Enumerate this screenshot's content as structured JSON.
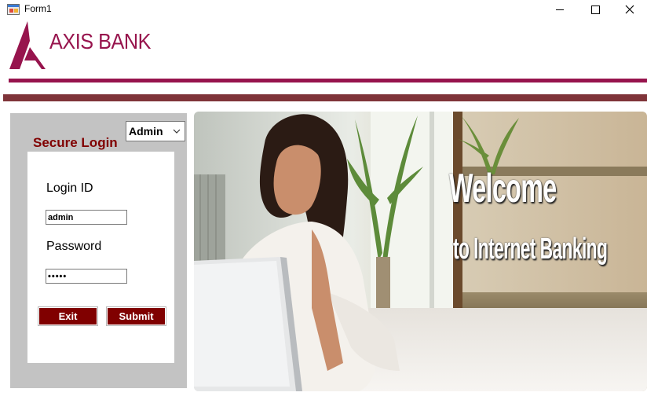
{
  "window": {
    "title": "Form1",
    "icon": "winforms-app-icon"
  },
  "header": {
    "brand": "AXIS BANK",
    "brand_color": "#97144d",
    "stripe_color": "#7f3439"
  },
  "login": {
    "role_selected": "Admin",
    "title": "Secure Login",
    "login_id_label": "Login ID",
    "login_id_value": "admin",
    "password_label": "Password",
    "password_value": "•••••",
    "exit_label": "Exit",
    "submit_label": "Submit",
    "accent_color": "#800000"
  },
  "banner": {
    "headline": "Welcome",
    "subline": "to Internet Banking"
  }
}
